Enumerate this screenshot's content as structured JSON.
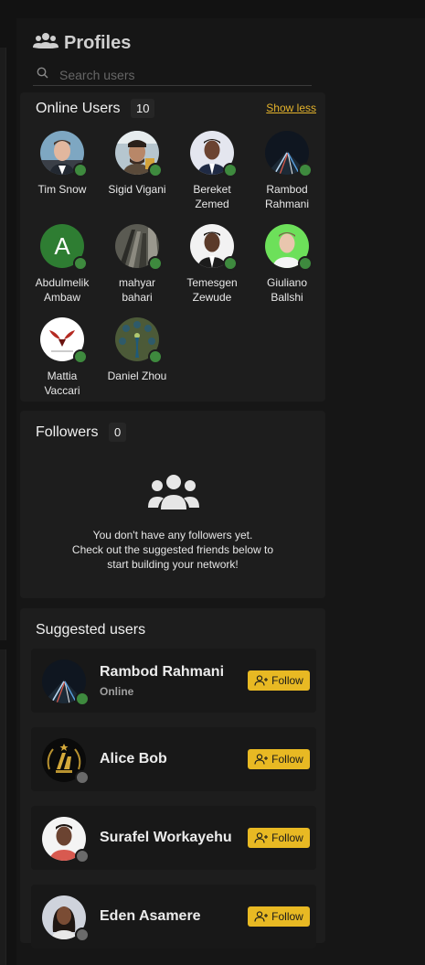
{
  "header": {
    "title": "Profiles",
    "icon": "users-icon"
  },
  "search": {
    "placeholder": "Search users"
  },
  "online": {
    "title": "Online Users",
    "count": "10",
    "toggle_label": "Show less",
    "users": [
      {
        "name": "Tim Snow",
        "status": "online"
      },
      {
        "name": "Sigid Vigani",
        "status": "online"
      },
      {
        "name": "Bereket Zemed",
        "status": "online"
      },
      {
        "name": "Rambod Rahmani",
        "status": "online"
      },
      {
        "name": "Abdulmelik Ambaw",
        "status": "online",
        "initial": "A"
      },
      {
        "name": "mahyar bahari",
        "status": "online"
      },
      {
        "name": "Temesgen Zewude",
        "status": "online"
      },
      {
        "name": "Giuliano Ballshi",
        "status": "online"
      },
      {
        "name": "Mattia Vaccari",
        "status": "online"
      },
      {
        "name": "Daniel Zhou",
        "status": "online"
      }
    ]
  },
  "followers": {
    "title": "Followers",
    "count": "0",
    "empty_line1": "You don't have any followers yet.",
    "empty_line2": "Check out the suggested friends below to",
    "empty_line3": "start building your network!"
  },
  "suggested": {
    "title": "Suggested users",
    "follow_label": "Follow",
    "users": [
      {
        "name": "Rambod Rahmani",
        "status_text": "Online",
        "online": true
      },
      {
        "name": "Alice Bob",
        "status_text": "",
        "online": false
      },
      {
        "name": "Surafel Workayehu",
        "status_text": "",
        "online": false
      },
      {
        "name": "Eden Asamere",
        "status_text": "",
        "online": false
      }
    ]
  },
  "colors": {
    "accent": "#e8b923",
    "online": "#3e8a3e",
    "offline": "#6a6a6a"
  }
}
